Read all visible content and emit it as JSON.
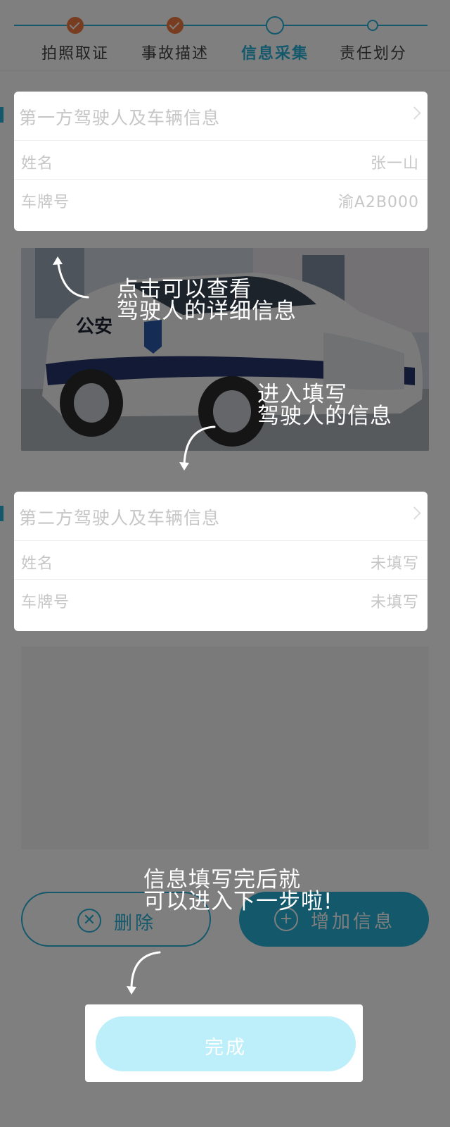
{
  "steps": [
    {
      "label": "拍照取证",
      "state": "done"
    },
    {
      "label": "事故描述",
      "state": "done"
    },
    {
      "label": "信息采集",
      "state": "current"
    },
    {
      "label": "责任划分",
      "state": "todo"
    }
  ],
  "party1": {
    "title": "第一方驾驶人及车辆信息",
    "name_label": "姓名",
    "name_value": "张一山",
    "plate_label": "车牌号",
    "plate_value": "渝A2B000",
    "photo_text": "公安"
  },
  "party2": {
    "title": "第二方驾驶人及车辆信息",
    "name_label": "姓名",
    "name_value": "未填写",
    "plate_label": "车牌号",
    "plate_value": "未填写"
  },
  "buttons": {
    "delete_label": "删除",
    "delete_icon": "✕",
    "add_label": "增加信息",
    "add_icon": "+",
    "done_label": "完成"
  },
  "guide": {
    "tip1_line1": "点击可以查看",
    "tip1_line2": "驾驶人的详细信息",
    "tip2_line1": "进入填写",
    "tip2_line2": "驾驶人的信息",
    "tip3_line1": "信息填写完后就",
    "tip3_line2": "可以进入下一步啦!"
  },
  "colors": {
    "accent": "#29b0d8",
    "done_step": "#f07a42",
    "overlay": "rgba(0,0,0,0.5)"
  }
}
